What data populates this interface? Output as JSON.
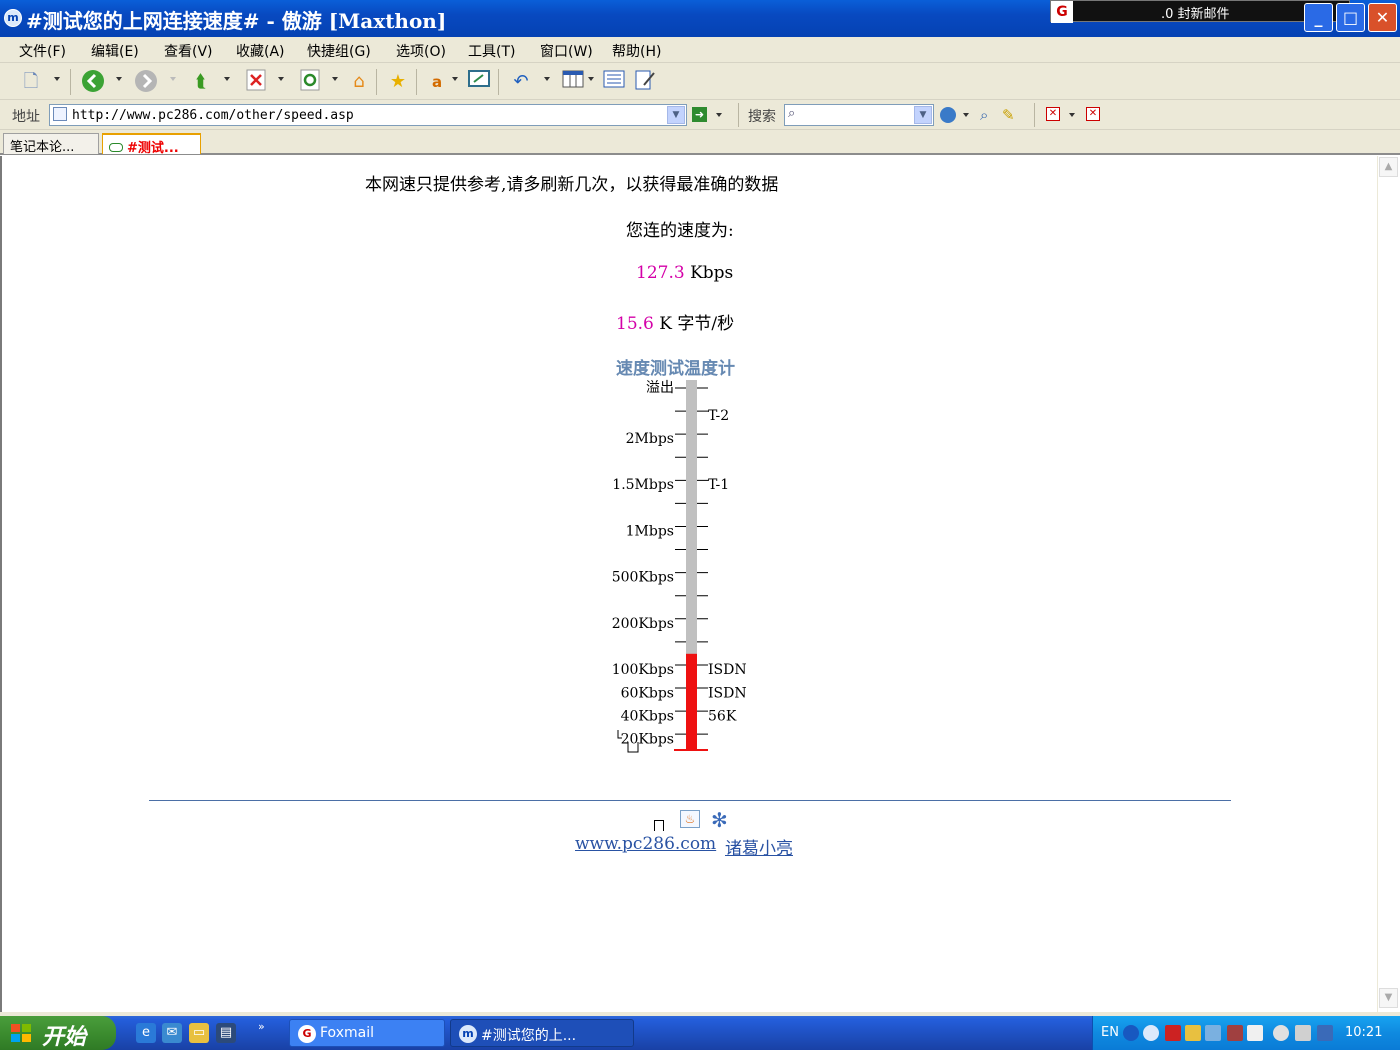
{
  "window": {
    "title": "#测试您的上网连接速度# - 傲游 [Maxthon]",
    "app_icon_glyph": "m",
    "notification": {
      "text": ".0 封新邮件",
      "icon": "foxmail-icon"
    }
  },
  "menu": [
    "文件(F)",
    "编辑(E)",
    "查看(V)",
    "收藏(A)",
    "快捷组(G)",
    "选项(O)",
    "工具(T)",
    "窗口(W)",
    "帮助(H)"
  ],
  "address": {
    "label": "地址",
    "url": "http://www.pc286.com/other/speed.asp"
  },
  "search": {
    "label": "搜索",
    "value": ""
  },
  "tabs": [
    {
      "label": "笔记本论...",
      "active": false
    },
    {
      "label": "#测试...",
      "active": true
    }
  ],
  "page": {
    "notice": "本网速只提供参考,请多刷新几次，以获得最准确的数据",
    "speed_label": "您连的速度为:",
    "speed_kbps_value": "127.3",
    "speed_kbps_unit": "Kbps",
    "speed_kb_value": "15.6",
    "speed_kb_unit": "K 字节/秒",
    "thermometer_title": "速度测试温度计",
    "footer_links": [
      "www.pc286.com",
      "诸葛小亮"
    ]
  },
  "chart_data": {
    "type": "bar",
    "title": "速度测试温度计",
    "value_kbps": 127.3,
    "left_labels": [
      "溢出",
      "2Mbps",
      "1.5Mbps",
      "1Mbps",
      "500Kbps",
      "200Kbps",
      "100Kbps",
      "60Kbps",
      "40Kbps",
      "20Kbps"
    ],
    "right_labels": [
      "T-2",
      "T-1",
      "ISDN",
      "ISDN",
      "56K"
    ],
    "fill_fraction": 0.26,
    "colors": {
      "fill": "#ee1111",
      "empty": "#c0c0c0"
    }
  },
  "taskbar": {
    "start_label": "开始",
    "tasks": [
      {
        "label": "Foxmail",
        "icon": "foxmail-icon"
      },
      {
        "label": "#测试您的上...",
        "icon": "maxthon-icon"
      }
    ],
    "lang": "EN",
    "clock": "10:21"
  }
}
